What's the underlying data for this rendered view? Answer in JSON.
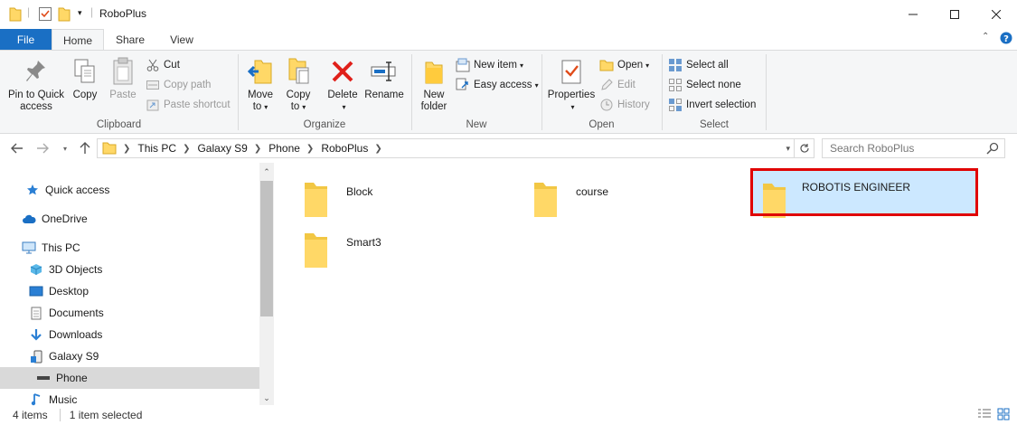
{
  "window": {
    "title": "RoboPlus",
    "controls": [
      "minimize",
      "maximize",
      "close"
    ]
  },
  "ribbon_tabs": {
    "file": "File",
    "home": "Home",
    "share": "Share",
    "view": "View"
  },
  "clipboard": {
    "caption": "Clipboard",
    "pin_line1": "Pin to Quick",
    "pin_line2": "access",
    "copy": "Copy",
    "paste": "Paste",
    "cut": "Cut",
    "copy_path": "Copy path",
    "paste_shortcut": "Paste shortcut"
  },
  "organize": {
    "caption": "Organize",
    "move_line1": "Move",
    "move_line2": "to",
    "copy_line1": "Copy",
    "copy_line2": "to",
    "delete": "Delete",
    "rename": "Rename"
  },
  "new_group": {
    "caption": "New",
    "new_folder_line1": "New",
    "new_folder_line2": "folder",
    "new_item": "New item",
    "easy_access": "Easy access"
  },
  "open_group": {
    "caption": "Open",
    "properties": "Properties",
    "open": "Open",
    "edit": "Edit",
    "history": "History"
  },
  "select_group": {
    "caption": "Select",
    "select_all": "Select all",
    "select_none": "Select none",
    "invert_selection": "Invert selection"
  },
  "address": {
    "crumbs": [
      "This PC",
      "Galaxy S9",
      "Phone",
      "RoboPlus"
    ],
    "search_placeholder": "Search RoboPlus"
  },
  "nav_pane": {
    "items": [
      "Quick access",
      "OneDrive",
      "This PC",
      "3D Objects",
      "Desktop",
      "Documents",
      "Downloads",
      "Galaxy S9",
      "Phone",
      "Music"
    ],
    "selected": "Phone"
  },
  "files": {
    "items": [
      "Block",
      "course",
      "ROBOTIS ENGINEER",
      "Smart3"
    ],
    "selected": "ROBOTIS ENGINEER"
  },
  "status": {
    "item_count": "4 items",
    "selection": "1 item selected"
  },
  "colors": {
    "accent": "#1a6fc4",
    "selection": "#cce8ff",
    "highlight_box": "#e00000",
    "folder": "#ffd867"
  }
}
